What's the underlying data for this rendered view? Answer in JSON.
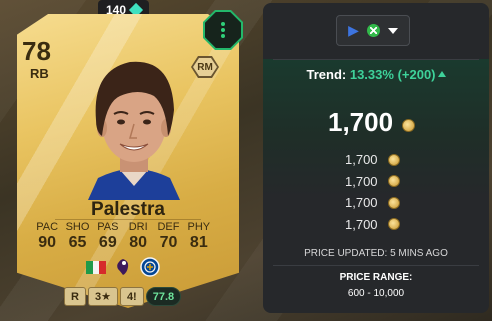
{
  "card": {
    "rating": "78",
    "position": "RB",
    "alt_position": "RM",
    "name": "Palestra",
    "stats": [
      {
        "label": "PAC",
        "value": "90"
      },
      {
        "label": "SHO",
        "value": "65"
      },
      {
        "label": "PAS",
        "value": "69"
      },
      {
        "label": "DRI",
        "value": "80"
      },
      {
        "label": "DEF",
        "value": "70"
      },
      {
        "label": "PHY",
        "value": "81"
      }
    ],
    "chips": {
      "foot": "R",
      "weak_foot": "3★",
      "skill_moves": "4!",
      "score": "77.8"
    },
    "colors": {
      "flag_green": "#1f9a49",
      "flag_white": "#f4f4f4",
      "flag_red": "#d62b2b",
      "score_green": "#6ee39b"
    }
  },
  "cost_badge": {
    "value": "140",
    "icon": "diamond-icon"
  },
  "chem_badge": {
    "icon": "vertical-dots-icon"
  },
  "price_panel": {
    "platform_icons": [
      "playstation-icon",
      "xbox-icon"
    ],
    "trend_label": "Trend:",
    "trend_percent": "13.33%",
    "trend_delta": "(+200)",
    "main_price": "1,700",
    "prices": [
      "1,700",
      "1,700",
      "1,700",
      "1,700"
    ],
    "updated": "PRICE UPDATED: 5 MINS AGO",
    "range_label": "PRICE RANGE:",
    "range_value": "600 - 10,000",
    "accent": "#3ed29a"
  }
}
